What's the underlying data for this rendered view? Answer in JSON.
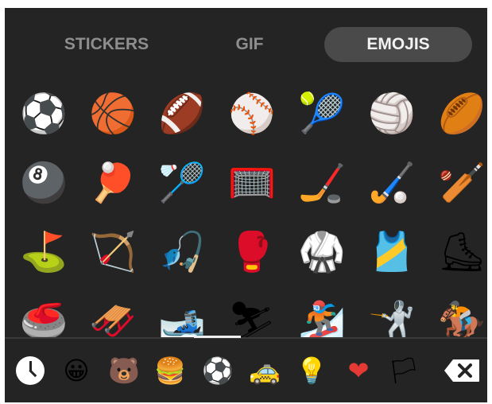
{
  "tabs": [
    {
      "label": "STICKERS",
      "active": false
    },
    {
      "label": "GIF",
      "active": false
    },
    {
      "label": "EMOJIS",
      "active": true
    }
  ],
  "colors": {
    "panel_bg": "#242424",
    "active_tab_bg": "#4a4a4a",
    "active_text": "#f2f2f2",
    "inactive_text": "#8e8e8e",
    "indicator": "#eeeeee"
  },
  "emoji_rows": [
    [
      {
        "name": "soccer-ball-emoji",
        "glyph": "⚽"
      },
      {
        "name": "basketball-emoji",
        "glyph": "🏀"
      },
      {
        "name": "american-football-emoji",
        "glyph": "🏈"
      },
      {
        "name": "baseball-emoji",
        "glyph": "⚾"
      },
      {
        "name": "tennis-emoji",
        "glyph": "🎾"
      },
      {
        "name": "volleyball-emoji",
        "glyph": "🏐"
      },
      {
        "name": "rugby-football-emoji",
        "glyph": "🏉"
      }
    ],
    [
      {
        "name": "pool-8-ball-emoji",
        "glyph": "🎱"
      },
      {
        "name": "ping-pong-emoji",
        "glyph": "🏓"
      },
      {
        "name": "badminton-emoji",
        "glyph": "🏸"
      },
      {
        "name": "goal-net-emoji",
        "glyph": "🥅"
      },
      {
        "name": "ice-hockey-emoji",
        "glyph": "🏒"
      },
      {
        "name": "field-hockey-emoji",
        "glyph": "🏑"
      },
      {
        "name": "cricket-game-emoji",
        "glyph": "🏏"
      }
    ],
    [
      {
        "name": "flag-in-hole-emoji",
        "glyph": "⛳"
      },
      {
        "name": "bow-and-arrow-emoji",
        "glyph": "🏹"
      },
      {
        "name": "fishing-pole-emoji",
        "glyph": "🎣"
      },
      {
        "name": "boxing-glove-emoji",
        "glyph": "🥊"
      },
      {
        "name": "martial-arts-uniform-emoji",
        "glyph": "🥋"
      },
      {
        "name": "running-shirt-emoji",
        "glyph": "🎽"
      },
      {
        "name": "ice-skate-emoji",
        "glyph": "⛸"
      }
    ],
    [
      {
        "name": "curling-stone-emoji",
        "glyph": "🥌"
      },
      {
        "name": "sled-emoji",
        "glyph": "🛷"
      },
      {
        "name": "skis-emoji",
        "glyph": "🎿"
      },
      {
        "name": "skier-emoji",
        "glyph": "⛷"
      },
      {
        "name": "snowboarder-emoji",
        "glyph": "🏂"
      },
      {
        "name": "person-fencing-emoji",
        "glyph": "🤺"
      },
      {
        "name": "horse-racing-emoji",
        "glyph": "🏇"
      }
    ]
  ],
  "categories": [
    {
      "name": "recent-clock-icon",
      "glyph": ""
    },
    {
      "name": "smileys-category-icon",
      "glyph": "😀"
    },
    {
      "name": "animals-category-icon",
      "glyph": "🐻"
    },
    {
      "name": "food-category-icon",
      "glyph": "🍔"
    },
    {
      "name": "activity-category-icon",
      "glyph": "⚽"
    },
    {
      "name": "travel-category-icon",
      "glyph": "🚕"
    },
    {
      "name": "objects-category-icon",
      "glyph": "💡"
    },
    {
      "name": "symbols-category-icon",
      "glyph": "❤"
    },
    {
      "name": "flags-category-icon",
      "glyph": "🏳"
    }
  ],
  "backspace_icon": "backspace-icon"
}
